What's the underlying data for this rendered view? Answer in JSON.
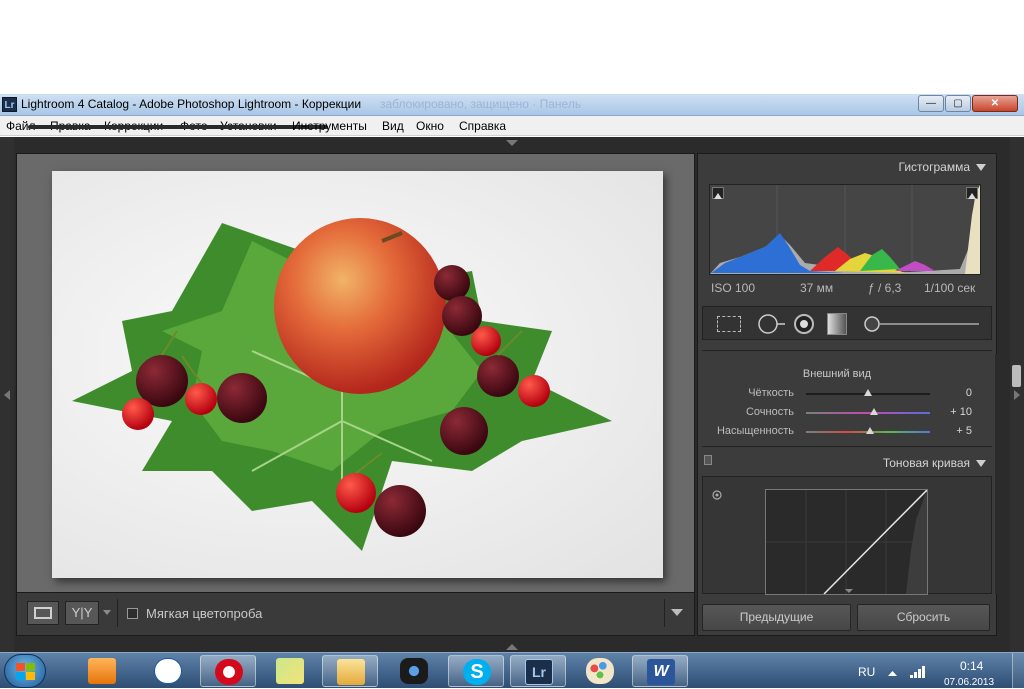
{
  "window": {
    "icon_label": "Lr",
    "title": "Lightroom 4 Catalog - Adobe Photoshop Lightroom - Коррекции",
    "ghost_text": "заблокировано, защищено · Панель",
    "controls": {
      "minimize": "—",
      "maximize": "▢",
      "close": "✕"
    }
  },
  "menu": {
    "items": [
      "Файл",
      "Правка",
      "Коррекции",
      "Фото",
      "Установки",
      "Инструменты",
      "Вид",
      "Окно",
      "Справка"
    ]
  },
  "histogram": {
    "title": "Гистограмма",
    "iso": "ISO 100",
    "focal": "37 мм",
    "aperture": "ƒ / 6,3",
    "shutter": "1/100 сек"
  },
  "presence": {
    "title": "Внешний вид",
    "sliders": [
      {
        "label": "Чёткость",
        "value": "0",
        "level": 0.5
      },
      {
        "label": "Сочность",
        "value": "+ 10",
        "level": 0.55
      },
      {
        "label": "Насыщенность",
        "value": "+ 5",
        "level": 0.52
      }
    ]
  },
  "tone_curve": {
    "title": "Тоновая кривая"
  },
  "buttons": {
    "previous": "Предыдущие",
    "reset": "Сбросить"
  },
  "toolbar": {
    "softproof_label": "Мягкая цветопроба",
    "view_yy": "Y|Y"
  },
  "taskbar": {
    "apps": [
      "Media Player",
      "People",
      "Opera",
      "Sticky Notes",
      "Explorer",
      "Webcam",
      "Skype",
      "Lightroom",
      "Paint",
      "Word"
    ],
    "active_app": "Lightroom",
    "language": "RU",
    "time": "0:14",
    "date": "07.06.2013"
  },
  "colors": {
    "lr_dark": "#2b2b2b",
    "panel": "#3c3c3c",
    "taskbar": "#2e4e74",
    "titlebar": "#a9c6e6"
  }
}
